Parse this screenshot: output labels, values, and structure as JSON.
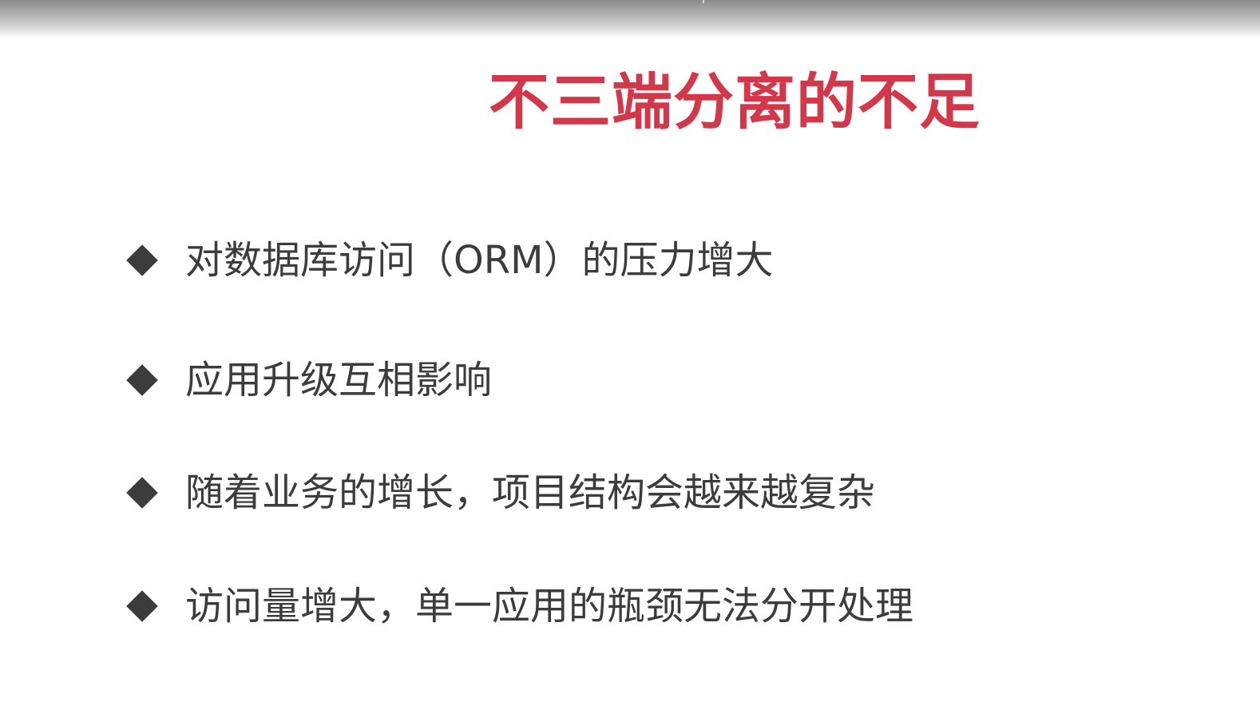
{
  "slide": {
    "title": "不三端分离的不足",
    "title_color": "#d2374a",
    "bullet_color": "#3c3c3c",
    "bullet_icon": "diamond-bullet-icon",
    "bullets": [
      {
        "text": "对数据库访问（ORM）的压力增大"
      },
      {
        "text": "应用升级互相影响"
      },
      {
        "text": "随着业务的增长，项目结构会越来越复杂"
      },
      {
        "text": "访问量增大，单一应用的瓶颈无法分开处理"
      }
    ]
  }
}
